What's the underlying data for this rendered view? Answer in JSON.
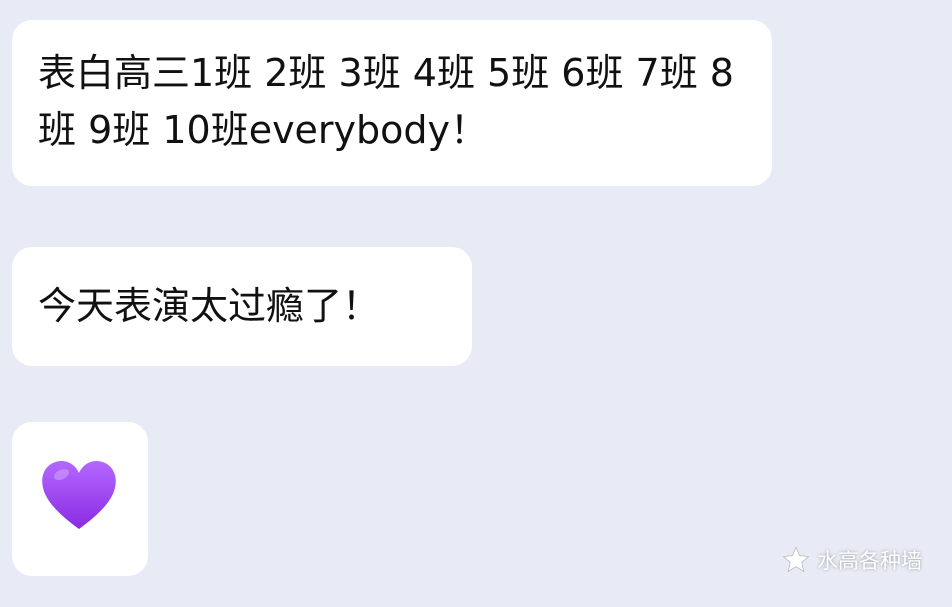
{
  "chat": {
    "messages": [
      {
        "text": "表白高三1班 2班 3班 4班 5班 6班 7班 8班 9班 10班everybody！"
      },
      {
        "text": "今天表演太过瘾了！"
      },
      {
        "emoji": "purple-heart",
        "color": "#9b3cf0"
      }
    ]
  },
  "watermark": {
    "text": "水高各种墙",
    "icon": "star-icon"
  },
  "colors": {
    "background": "#e8eaf5",
    "bubble": "#ffffff",
    "text": "#111111"
  }
}
